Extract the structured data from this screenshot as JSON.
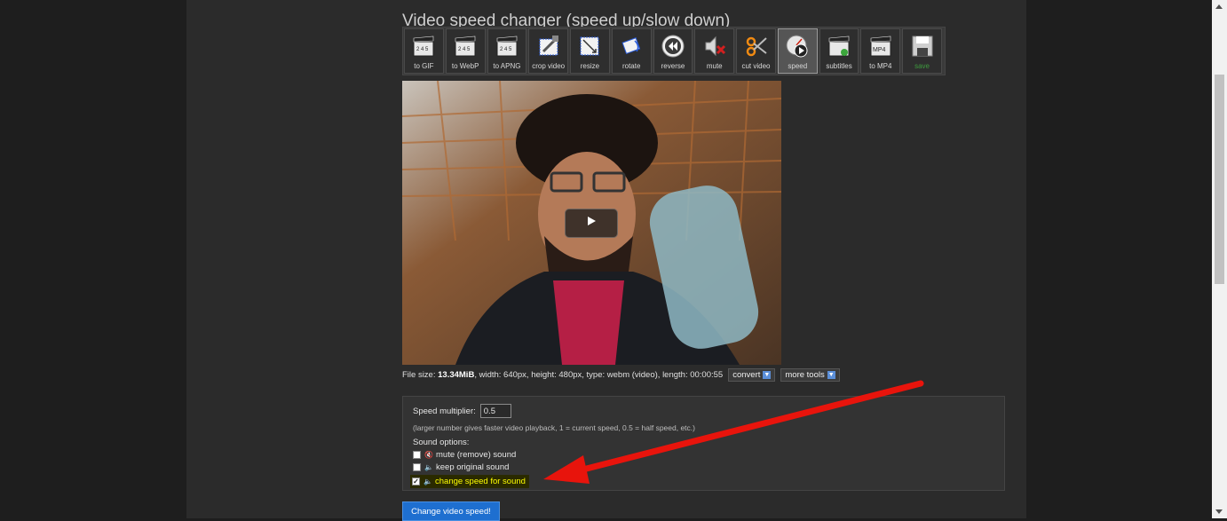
{
  "page": {
    "title": "Video speed changer (speed up/slow down)"
  },
  "toolbar": {
    "items": [
      {
        "label": "to GIF",
        "icon": "clapperboard-icon"
      },
      {
        "label": "to WebP",
        "icon": "clapperboard-icon"
      },
      {
        "label": "to APNG",
        "icon": "clapperboard-icon"
      },
      {
        "label": "crop video",
        "icon": "crop-icon"
      },
      {
        "label": "resize",
        "icon": "resize-icon"
      },
      {
        "label": "rotate",
        "icon": "rotate-icon"
      },
      {
        "label": "reverse",
        "icon": "reverse-icon"
      },
      {
        "label": "mute",
        "icon": "mute-icon"
      },
      {
        "label": "cut video",
        "icon": "scissors-icon"
      },
      {
        "label": "speed",
        "icon": "speedometer-icon",
        "active": true
      },
      {
        "label": "subtitles",
        "icon": "subtitles-icon"
      },
      {
        "label": "to MP4",
        "icon": "mp4-clapperboard-icon"
      },
      {
        "label": "save",
        "icon": "floppy-disk-icon"
      }
    ]
  },
  "file_info": {
    "prefix": "File size:",
    "size": "13.34MiB",
    "details": ", width: 640px, height: 480px, type: webm (video), length: 00:00:55",
    "convert_label": "convert",
    "more_tools_label": "more tools"
  },
  "options": {
    "speed_label": "Speed multiplier:",
    "speed_value": "0.5",
    "hint": "(larger number gives faster video playback, 1 = current speed, 0.5 = half speed, etc.)",
    "sound_label": "Sound options:",
    "sound_options": [
      {
        "label": "mute (remove) sound",
        "checked": false
      },
      {
        "label": "keep original sound",
        "checked": false
      },
      {
        "label": "change speed for sound",
        "checked": true
      }
    ]
  },
  "submit_label": "Change video speed!",
  "colors": {
    "background": "#1e1e1e",
    "panel": "#2b2b2b",
    "accent_blue": "#1e6fd0",
    "highlight": "#ffff00",
    "annotation_arrow": "#e8140c"
  }
}
